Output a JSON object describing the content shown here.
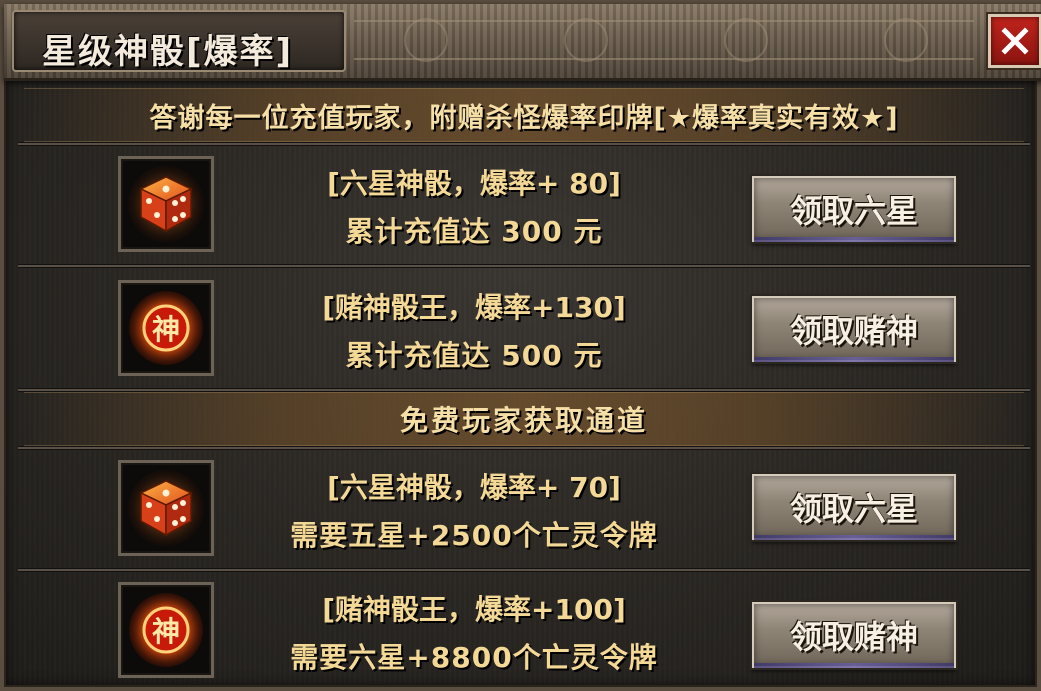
{
  "window": {
    "title": "星级神骰[爆率]",
    "close_label": "✕"
  },
  "paid_section": {
    "header": "答谢每一位充值玩家，附赠杀怪爆率印牌[★爆率真实有效★]",
    "rows": [
      {
        "icon": "dice-icon",
        "line1": "[六星神骰，爆率+ 80]",
        "line2": "累计充值达 300 元",
        "button": "领取六星"
      },
      {
        "icon": "gambler-god-icon",
        "line1": "[赌神骰王，爆率+130]",
        "line2": "累计充值达 500 元",
        "button": "领取赌神"
      }
    ]
  },
  "free_section": {
    "header": "免费玩家获取通道",
    "rows": [
      {
        "icon": "dice-icon",
        "line1": "[六星神骰，爆率+ 70]",
        "line2": "需要五星+2500个亡灵令牌",
        "button": "领取六星"
      },
      {
        "icon": "gambler-god-icon",
        "line1": "[赌神骰王，爆率+100]",
        "line2": "需要六星+8800个亡灵令牌",
        "button": "领取赌神"
      }
    ]
  },
  "icon_glyphs": {
    "god_char": "神"
  },
  "colors": {
    "text_gold": "#f4d896",
    "header_gold": "#f6dfa6",
    "close_red": "#c0241c",
    "button_stone": "#8f8577"
  }
}
